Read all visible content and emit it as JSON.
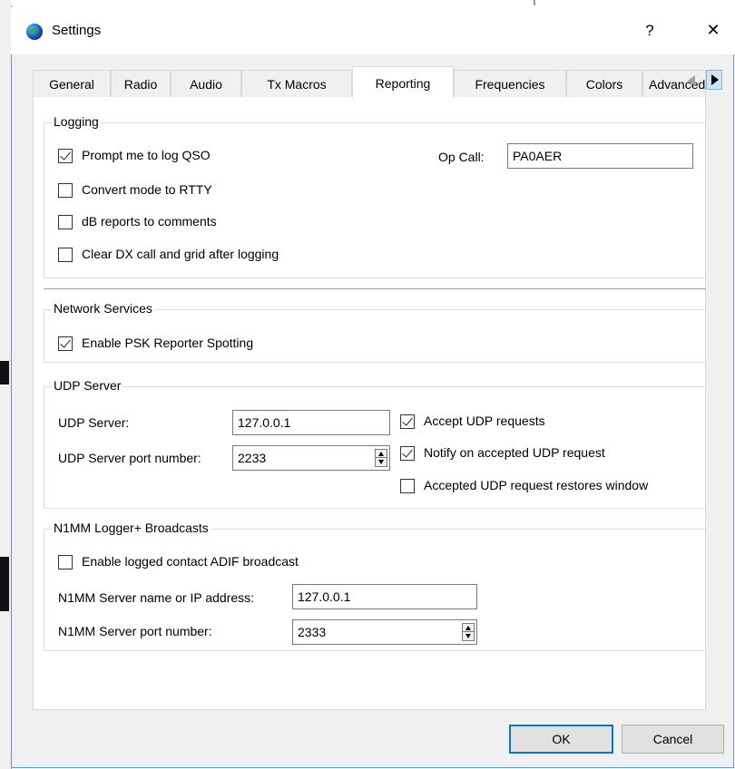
{
  "window": {
    "title": "Settings",
    "help": "?",
    "close": "✕"
  },
  "tabs": [
    {
      "label": "General"
    },
    {
      "label": "Radio"
    },
    {
      "label": "Audio"
    },
    {
      "label": "Tx Macros"
    },
    {
      "label": "Reporting"
    },
    {
      "label": "Frequencies"
    },
    {
      "label": "Colors"
    },
    {
      "label": "Advanced"
    }
  ],
  "active_tab": "Reporting",
  "logging": {
    "title": "Logging",
    "prompt_log": {
      "label": "Prompt me to log QSO",
      "checked": true
    },
    "convert_rtty": {
      "label": "Convert mode to RTTY",
      "checked": false
    },
    "db_reports": {
      "label": "dB reports to comments",
      "checked": false
    },
    "clear_dx": {
      "label": "Clear DX call and grid after logging",
      "checked": false
    },
    "op_call_label": "Op Call:",
    "op_call_value": "PA0AER"
  },
  "network": {
    "title": "Network Services",
    "psk": {
      "label": "Enable PSK Reporter Spotting",
      "checked": true
    }
  },
  "udp": {
    "title": "UDP Server",
    "server_label": "UDP Server:",
    "server_value": "127.0.0.1",
    "port_label": "UDP Server port number:",
    "port_value": "2233",
    "accept": {
      "label": "Accept UDP requests",
      "checked": true
    },
    "notify": {
      "label": "Notify on accepted UDP request",
      "checked": true
    },
    "restore": {
      "label": "Accepted UDP request restores window",
      "checked": false
    }
  },
  "n1mm": {
    "title": "N1MM Logger+ Broadcasts",
    "enable": {
      "label": "Enable logged contact ADIF broadcast",
      "checked": false
    },
    "server_label": "N1MM Server name or IP address:",
    "server_value": "127.0.0.1",
    "port_label": "N1MM Server port number:",
    "port_value": "2333"
  },
  "buttons": {
    "ok": "OK",
    "cancel": "Cancel"
  },
  "colors": {
    "accent": "#0078d7",
    "window_bg": "#f0f0f0"
  }
}
